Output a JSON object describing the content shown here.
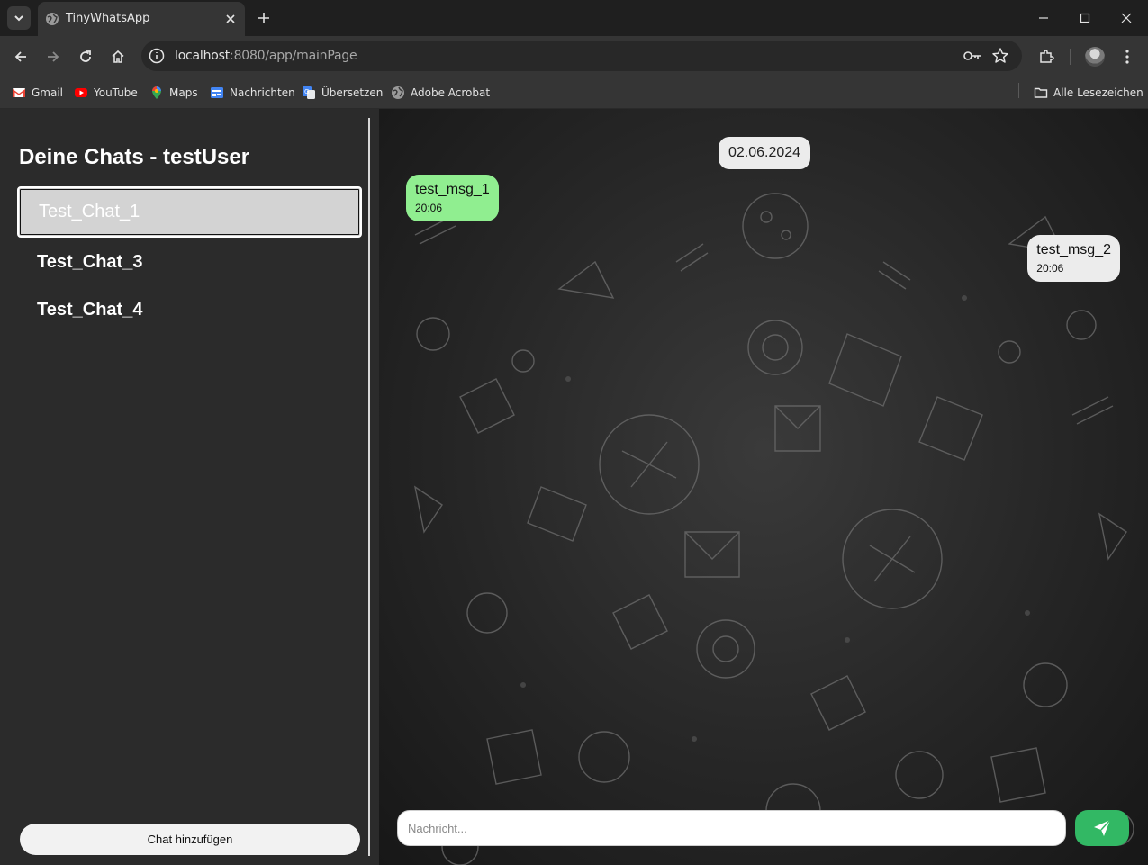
{
  "browser": {
    "tab": {
      "title": "TinyWhatsApp",
      "favicon": "globe-icon"
    },
    "url_host": "localhost",
    "url_path": ":8080/app/mainPage",
    "bookmarks": [
      {
        "label": "Gmail",
        "icon": "gmail-icon"
      },
      {
        "label": "YouTube",
        "icon": "youtube-icon"
      },
      {
        "label": "Maps",
        "icon": "maps-icon"
      },
      {
        "label": "Nachrichten",
        "icon": "news-icon"
      },
      {
        "label": "Übersetzen",
        "icon": "translate-icon"
      },
      {
        "label": "Adobe Acrobat",
        "icon": "globe-icon"
      }
    ],
    "all_bookmarks_label": "Alle Lesezeichen"
  },
  "sidebar": {
    "title": "Deine Chats - testUser",
    "chats": [
      {
        "label": "Test_Chat_1",
        "active": true
      },
      {
        "label": "Test_Chat_3",
        "active": false
      },
      {
        "label": "Test_Chat_4",
        "active": false
      }
    ],
    "add_chat_label": "Chat hinzufügen"
  },
  "chat": {
    "date": "02.06.2024",
    "messages": [
      {
        "text": "test_msg_1",
        "time": "20:06",
        "direction": "incoming",
        "color": "#90ee90"
      },
      {
        "text": "test_msg_2",
        "time": "20:06",
        "direction": "outgoing",
        "color": "#ececec"
      }
    ],
    "composer": {
      "placeholder": "Nachricht...",
      "send_icon": "paper-plane-icon",
      "send_color": "#32b864"
    }
  }
}
